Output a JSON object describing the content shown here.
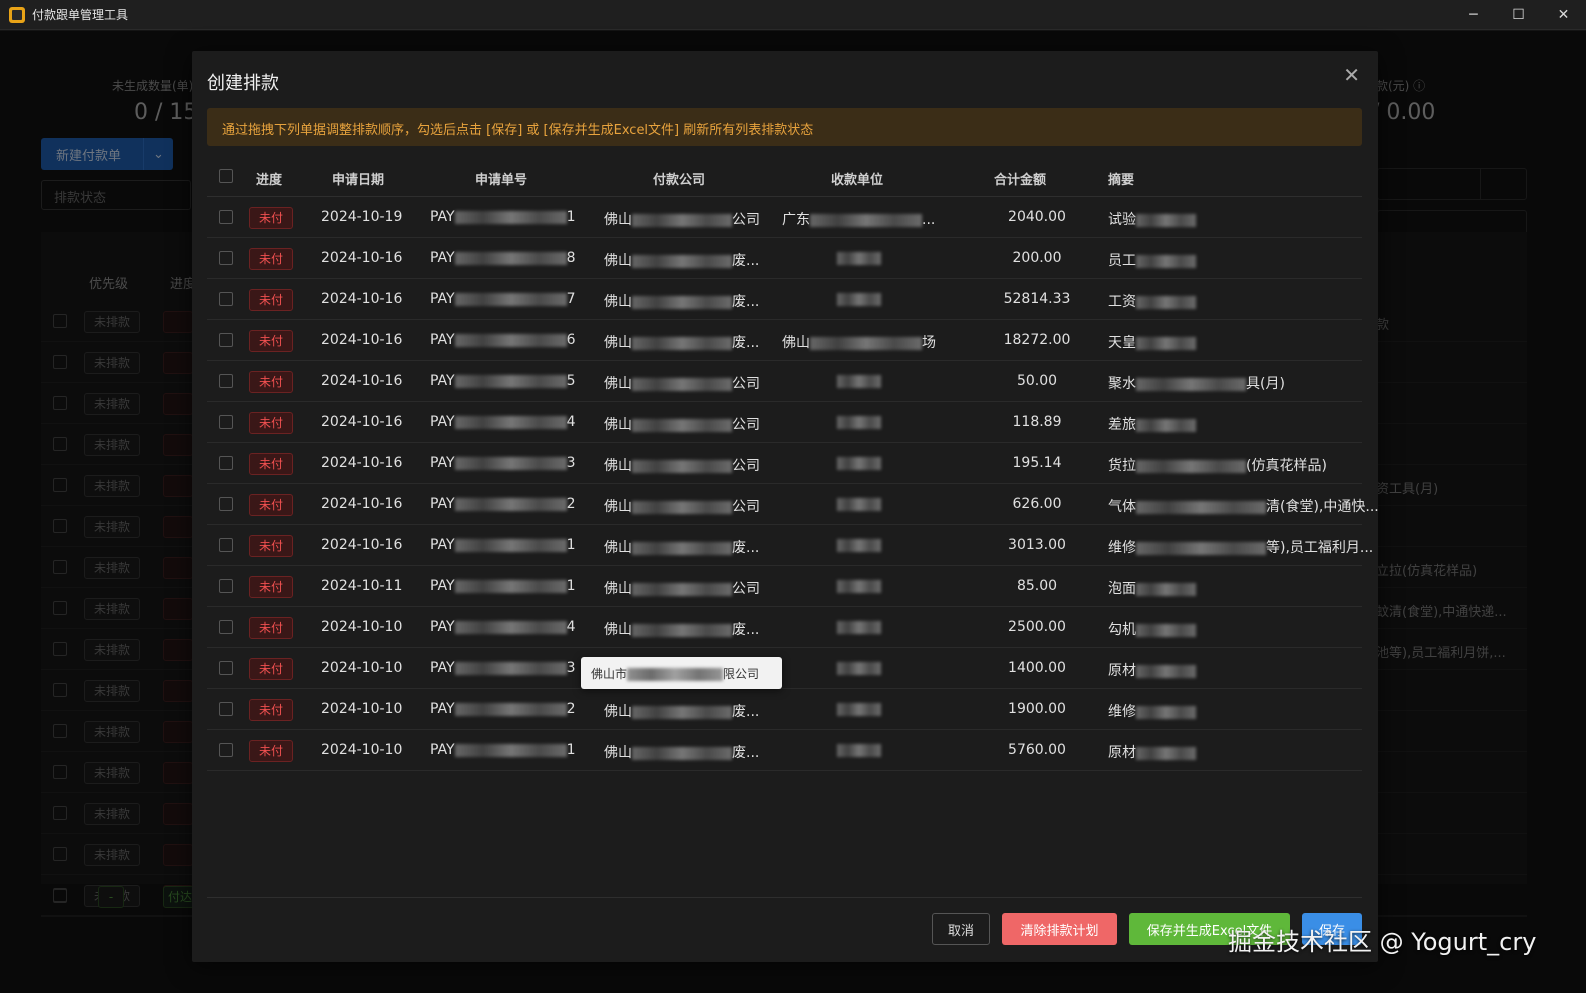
{
  "window": {
    "title": "付款跟单管理工具",
    "controls": [
      "─",
      "☐",
      "✕"
    ]
  },
  "background": {
    "stat_left_label": "未生成数量(单)",
    "stat_left_value": "0 / 15",
    "stat_right_label": "款(元) ⓘ",
    "stat_right_value": "/ 0.00",
    "new_button": "新建付款单",
    "status_select": "排款状态",
    "col_priority": "优先级",
    "col_progress": "进度",
    "row_tag": "未排款",
    "right_texts": [
      "款",
      "资工具(月)",
      "立拉(仿真花样品)",
      "蚊清(食堂),中通快递...",
      "池等),员工福利月饼,..."
    ],
    "last_row_tag": "-",
    "last_row_status": "付达"
  },
  "modal": {
    "title": "创建排款",
    "close": "✕",
    "alert": "通过拖拽下列单据调整排款顺序，勾选后点击 [保存] 或 [保存并生成Excel文件] 刷新所有列表排款状态",
    "columns": [
      "进度",
      "申请日期",
      "申请单号",
      "付款公司",
      "收款单位",
      "合计金额",
      "摘要"
    ],
    "rows": [
      {
        "status": "未付",
        "date": "2024-10-19",
        "no_prefix": "PAY",
        "no_suffix": "1",
        "payer_prefix": "佛山",
        "payer_suffix": "公司",
        "recv_prefix": "广东",
        "recv_suffix": "...",
        "amount": "2040.00",
        "summary_prefix": "试验",
        "summary_suffix": ""
      },
      {
        "status": "未付",
        "date": "2024-10-16",
        "no_prefix": "PAY",
        "no_suffix": "8",
        "payer_prefix": "佛山",
        "payer_suffix": "废...",
        "recv_prefix": "",
        "recv_suffix": "",
        "amount": "200.00",
        "summary_prefix": "员工",
        "summary_suffix": ""
      },
      {
        "status": "未付",
        "date": "2024-10-16",
        "no_prefix": "PAY",
        "no_suffix": "7",
        "payer_prefix": "佛山",
        "payer_suffix": "废...",
        "recv_prefix": "",
        "recv_suffix": "",
        "amount": "52814.33",
        "summary_prefix": "工资",
        "summary_suffix": ""
      },
      {
        "status": "未付",
        "date": "2024-10-16",
        "no_prefix": "PAY",
        "no_suffix": "6",
        "payer_prefix": "佛山",
        "payer_suffix": "废...",
        "recv_prefix": "佛山",
        "recv_suffix": "场",
        "amount": "18272.00",
        "summary_prefix": "天皇",
        "summary_suffix": ""
      },
      {
        "status": "未付",
        "date": "2024-10-16",
        "no_prefix": "PAY",
        "no_suffix": "5",
        "payer_prefix": "佛山",
        "payer_suffix": "公司",
        "recv_prefix": "",
        "recv_suffix": "",
        "amount": "50.00",
        "summary_prefix": "聚水",
        "summary_suffix": "具(月)"
      },
      {
        "status": "未付",
        "date": "2024-10-16",
        "no_prefix": "PAY",
        "no_suffix": "4",
        "payer_prefix": "佛山",
        "payer_suffix": "公司",
        "recv_prefix": "",
        "recv_suffix": "",
        "amount": "118.89",
        "summary_prefix": "差旅",
        "summary_suffix": ""
      },
      {
        "status": "未付",
        "date": "2024-10-16",
        "no_prefix": "PAY",
        "no_suffix": "3",
        "payer_prefix": "佛山",
        "payer_suffix": "公司",
        "recv_prefix": "",
        "recv_suffix": "",
        "amount": "195.14",
        "summary_prefix": "货拉",
        "summary_suffix": "(仿真花样品)"
      },
      {
        "status": "未付",
        "date": "2024-10-16",
        "no_prefix": "PAY",
        "no_suffix": "2",
        "payer_prefix": "佛山",
        "payer_suffix": "公司",
        "recv_prefix": "",
        "recv_suffix": "",
        "amount": "626.00",
        "summary_prefix": "气体",
        "summary_suffix": "清(食堂),中通快..."
      },
      {
        "status": "未付",
        "date": "2024-10-16",
        "no_prefix": "PAY",
        "no_suffix": "1",
        "payer_prefix": "佛山",
        "payer_suffix": "废...",
        "recv_prefix": "",
        "recv_suffix": "",
        "amount": "3013.00",
        "summary_prefix": "维修",
        "summary_suffix": "等),员工福利月..."
      },
      {
        "status": "未付",
        "date": "2024-10-11",
        "no_prefix": "PAY",
        "no_suffix": "1",
        "payer_prefix": "佛山",
        "payer_suffix": "公司",
        "recv_prefix": "",
        "recv_suffix": "",
        "amount": "85.00",
        "summary_prefix": "泡面",
        "summary_suffix": ""
      },
      {
        "status": "未付",
        "date": "2024-10-10",
        "no_prefix": "PAY",
        "no_suffix": "4",
        "payer_prefix": "佛山",
        "payer_suffix": "废...",
        "recv_prefix": "",
        "recv_suffix": "",
        "amount": "2500.00",
        "summary_prefix": "勾机",
        "summary_suffix": ""
      },
      {
        "status": "未付",
        "date": "2024-10-10",
        "no_prefix": "PAY",
        "no_suffix": "3",
        "payer_prefix": "",
        "payer_suffix": "",
        "recv_prefix": "",
        "recv_suffix": "",
        "amount": "1400.00",
        "summary_prefix": "原材",
        "summary_suffix": ""
      },
      {
        "status": "未付",
        "date": "2024-10-10",
        "no_prefix": "PAY",
        "no_suffix": "2",
        "payer_prefix": "佛山",
        "payer_suffix": "废...",
        "recv_prefix": "",
        "recv_suffix": "",
        "amount": "1900.00",
        "summary_prefix": "维修",
        "summary_suffix": ""
      },
      {
        "status": "未付",
        "date": "2024-10-10",
        "no_prefix": "PAY",
        "no_suffix": "1",
        "payer_prefix": "佛山",
        "payer_suffix": "废...",
        "recv_prefix": "",
        "recv_suffix": "",
        "amount": "5760.00",
        "summary_prefix": "原材",
        "summary_suffix": ""
      }
    ],
    "tooltip": {
      "prefix": "佛山市",
      "suffix": "限公司"
    },
    "buttons": {
      "cancel": "取消",
      "clear": "清除排款计划",
      "save_excel": "保存并生成Excel文件",
      "save": "保存"
    }
  },
  "watermark": "掘金技术社区 @ Yogurt_cry",
  "colors": {
    "accent_blue": "#3a8ee6",
    "danger_red": "#ef6767",
    "success_green": "#5fb83a",
    "warning_orange": "#e8a33d"
  }
}
